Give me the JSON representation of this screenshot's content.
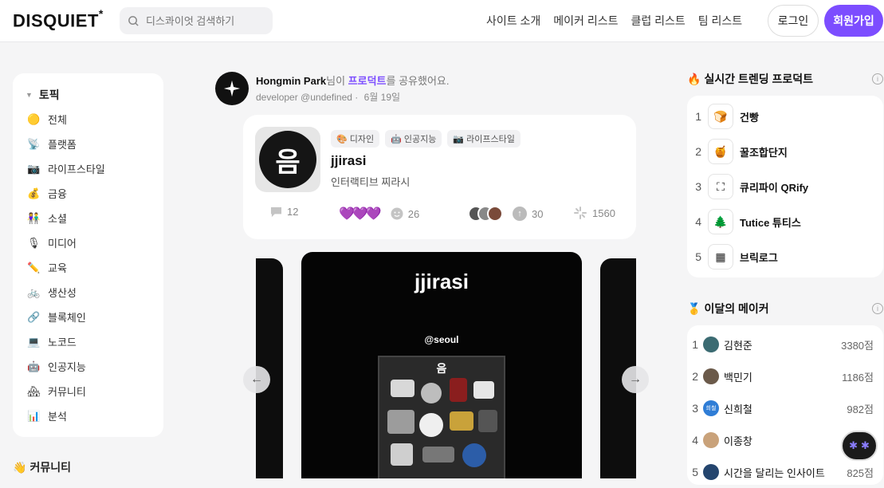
{
  "header": {
    "logo": "DISQUIET",
    "logo_mark": "*",
    "search_placeholder": "디스콰이엇 검색하기",
    "nav": [
      "사이트 소개",
      "메이커 리스트",
      "클럽 리스트",
      "팀 리스트"
    ],
    "login_label": "로그인",
    "signup_label": "회원가입",
    "accent_color": "#7c4dff"
  },
  "sidebar": {
    "title": "토픽",
    "items": [
      {
        "icon": "🟡",
        "label": "전체"
      },
      {
        "icon": "📡",
        "label": "플랫폼"
      },
      {
        "icon": "📷",
        "label": "라이프스타일"
      },
      {
        "icon": "💰",
        "label": "금융"
      },
      {
        "icon": "👫",
        "label": "소셜"
      },
      {
        "icon": "🎙",
        "label": "미디어"
      },
      {
        "icon": "✏️",
        "label": "교육"
      },
      {
        "icon": "🚲",
        "label": "생산성"
      },
      {
        "icon": "🔗",
        "label": "블록체인"
      },
      {
        "icon": "💻",
        "label": "노코드"
      },
      {
        "icon": "🤖",
        "label": "인공지능"
      },
      {
        "icon": "🏘",
        "label": "커뮤니티"
      },
      {
        "icon": "📊",
        "label": "분석"
      }
    ],
    "community_icon": "👋",
    "community_label": "커뮤니티"
  },
  "feed": {
    "author": "Hongmin Park",
    "action_prefix": "님이 ",
    "action_link": "프로덕트",
    "action_suffix": "를 공유했어요.",
    "meta": "developer @undefined",
    "date": "6월 19일",
    "product": {
      "thumb_glyph": "음",
      "tags": [
        "🎨 디자인",
        "🤖 인공지능",
        "📷 라이프스타일"
      ],
      "name": "jjirasi",
      "description": "인터랙티브 찌라시",
      "comments": "12",
      "reactions": "26",
      "upvotes": "30",
      "views": "1560"
    },
    "gallery": {
      "title": "jjirasi",
      "location": "@seoul",
      "photo_glyph": "음",
      "prev_icon": "←",
      "next_icon": "→"
    }
  },
  "trending": {
    "icon": "🔥",
    "title": "실시간 트렌딩 프로덕트",
    "items": [
      {
        "rank": "1",
        "name": "건빵",
        "logo": "🍞"
      },
      {
        "rank": "2",
        "name": "꿀조합단지",
        "logo": "🍯"
      },
      {
        "rank": "3",
        "name": "큐리파이 QRify",
        "logo": "⛶"
      },
      {
        "rank": "4",
        "name": "Tutice 튜티스",
        "logo": "🌲"
      },
      {
        "rank": "5",
        "name": "브릭로그",
        "logo": "▦"
      }
    ]
  },
  "makers": {
    "icon": "🥇",
    "title": "이달의 메이커",
    "items": [
      {
        "rank": "1",
        "name": "김현준",
        "points": "3380점",
        "avatar_color": "#3b6b72"
      },
      {
        "rank": "2",
        "name": "백민기",
        "points": "1186점",
        "avatar_color": "#6b5a4a"
      },
      {
        "rank": "3",
        "name": "신희철",
        "points": "982점",
        "avatar_color": "#2f7dd6",
        "avatar_text": "희철"
      },
      {
        "rank": "4",
        "name": "이종창",
        "points": "",
        "avatar_color": "#c9a27a"
      },
      {
        "rank": "5",
        "name": "시간을 달리는 인사이트",
        "points": "825점",
        "avatar_color": "#24456e"
      }
    ]
  }
}
